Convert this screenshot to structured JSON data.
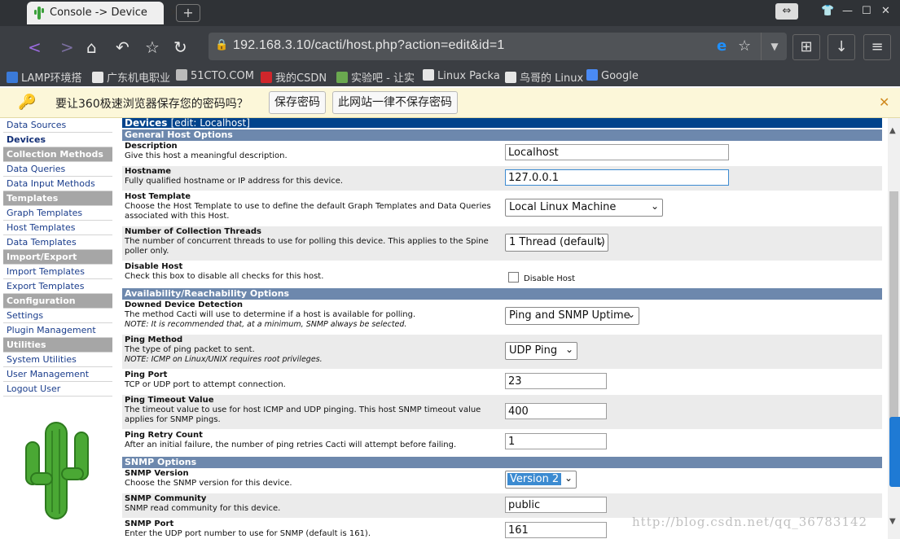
{
  "browser": {
    "tab_title": "Console -> Device",
    "url": "192.168.3.10/cacti/host.php?action=edit&id=1",
    "bookmarks": [
      {
        "label": "LAMP环境搭",
        "color": "#3b7ad8"
      },
      {
        "label": "广东机电职业",
        "color": "#e6e6e6"
      },
      {
        "label": "51CTO.COM",
        "color": "#bbbbbb"
      },
      {
        "label": "我的CSDN",
        "color": "#d0262b"
      },
      {
        "label": "实验吧 - 让实",
        "color": "#6aa84f"
      },
      {
        "label": "Linux Packa",
        "color": "#e6e6e6"
      },
      {
        "label": "鸟哥的 Linux",
        "color": "#e6e6e6"
      },
      {
        "label": "Google",
        "color": "#4a8af4"
      }
    ]
  },
  "infobar": {
    "message": "要让360极速浏览器保存您的密码吗？",
    "save_label": "保存密码",
    "never_label": "此网站一律不保存密码"
  },
  "sidebar": {
    "items": [
      {
        "label": "Data Sources",
        "type": "link"
      },
      {
        "label": "Devices",
        "type": "active"
      },
      {
        "label": "Collection Methods",
        "type": "head"
      },
      {
        "label": "Data Queries",
        "type": "link"
      },
      {
        "label": "Data Input Methods",
        "type": "link"
      },
      {
        "label": "Templates",
        "type": "head"
      },
      {
        "label": "Graph Templates",
        "type": "link"
      },
      {
        "label": "Host Templates",
        "type": "link"
      },
      {
        "label": "Data Templates",
        "type": "link"
      },
      {
        "label": "Import/Export",
        "type": "head"
      },
      {
        "label": "Import Templates",
        "type": "link"
      },
      {
        "label": "Export Templates",
        "type": "link"
      },
      {
        "label": "Configuration",
        "type": "head"
      },
      {
        "label": "Settings",
        "type": "link"
      },
      {
        "label": "Plugin Management",
        "type": "link"
      },
      {
        "label": "Utilities",
        "type": "head"
      },
      {
        "label": "System Utilities",
        "type": "link"
      },
      {
        "label": "User Management",
        "type": "link"
      },
      {
        "label": "Logout User",
        "type": "link"
      }
    ]
  },
  "main": {
    "title": "Devices",
    "title_sub": "[edit: Localhost]",
    "sections": [
      {
        "header": "General Host Options",
        "rows": [
          {
            "name": "Description",
            "desc": "Give this host a meaningful description.",
            "kind": "text",
            "value": "Localhost",
            "w": 275,
            "alt": false,
            "h": 30
          },
          {
            "name": "Hostname",
            "desc": "Fully qualified hostname or IP address for this device.",
            "kind": "text",
            "value": "127.0.0.1",
            "w": 275,
            "alt": true,
            "h": 30,
            "focus": true
          },
          {
            "name": "Host Template",
            "desc": "Choose the Host Template to use to define the default Graph Templates and Data Queries associated with this Host.",
            "kind": "select",
            "value": "Local Linux Machine",
            "w": 194,
            "alt": false,
            "h": 42
          },
          {
            "name": "Number of Collection Threads",
            "desc": "The number of concurrent threads to use for polling this device. This applies to the Spine poller only.",
            "kind": "select",
            "value": "1 Thread (default)",
            "w": 127,
            "alt": true,
            "h": 42
          },
          {
            "name": "Disable Host",
            "desc": "Check this box to disable all checks for this host.",
            "kind": "checkbox",
            "value": "Disable Host",
            "alt": false,
            "h": 30
          }
        ]
      },
      {
        "header": "Availability/Reachability Options",
        "rows": [
          {
            "name": "Downed Device Detection",
            "desc": "The method Cacti will use to determine if a host is available for polling.",
            "note": "NOTE: It is recommended that, at a minimum, SNMP always be selected.",
            "kind": "select",
            "value": "Ping and SNMP Uptime",
            "w": 165,
            "alt": false,
            "h": 42
          },
          {
            "name": "Ping Method",
            "desc": "The type of ping packet to sent.",
            "note": "NOTE: ICMP on Linux/UNIX requires root privileges.",
            "kind": "select",
            "value": "UDP Ping",
            "w": 89,
            "alt": true,
            "h": 42
          },
          {
            "name": "Ping Port",
            "desc": "TCP or UDP port to attempt connection.",
            "kind": "text",
            "value": "23",
            "w": 125,
            "alt": false,
            "h": 30
          },
          {
            "name": "Ping Timeout Value",
            "desc": "The timeout value to use for host ICMP and UDP pinging. This host SNMP timeout value applies for SNMP pings.",
            "kind": "text",
            "value": "400",
            "w": 125,
            "alt": true,
            "h": 42
          },
          {
            "name": "Ping Retry Count",
            "desc": "After an initial failure, the number of ping retries Cacti will attempt before failing.",
            "kind": "text",
            "value": "1",
            "w": 125,
            "alt": false,
            "h": 30
          }
        ]
      },
      {
        "header": "SNMP Options",
        "rows": [
          {
            "name": "SNMP Version",
            "desc": "Choose the SNMP version for this device.",
            "kind": "select",
            "value": "Version 2",
            "w": 88,
            "alt": false,
            "h": 30,
            "highlight": true
          },
          {
            "name": "SNMP Community",
            "desc": "SNMP read community for this device.",
            "kind": "text",
            "value": "public",
            "w": 125,
            "alt": true,
            "h": 30
          },
          {
            "name": "SNMP Port",
            "desc": "Enter the UDP port number to use for SNMP (default is 161).",
            "kind": "text",
            "value": "161",
            "w": 125,
            "alt": false,
            "h": 30
          }
        ]
      }
    ]
  },
  "watermark": "http://blog.csdn.net/qq_36783142"
}
